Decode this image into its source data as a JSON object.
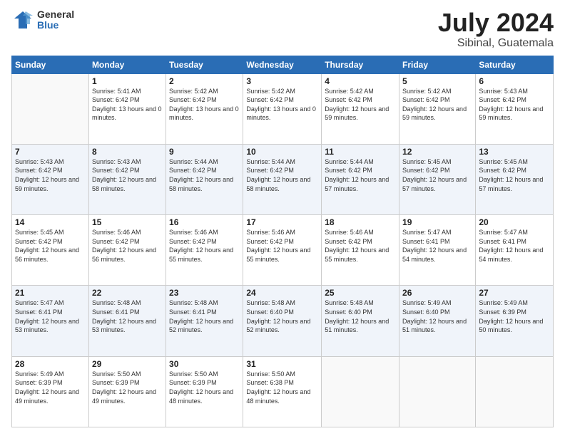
{
  "logo": {
    "general": "General",
    "blue": "Blue"
  },
  "title": {
    "month_year": "July 2024",
    "location": "Sibinal, Guatemala"
  },
  "days_of_week": [
    "Sunday",
    "Monday",
    "Tuesday",
    "Wednesday",
    "Thursday",
    "Friday",
    "Saturday"
  ],
  "weeks": [
    [
      {
        "num": "",
        "sunrise": "",
        "sunset": "",
        "daylight": ""
      },
      {
        "num": "1",
        "sunrise": "Sunrise: 5:41 AM",
        "sunset": "Sunset: 6:42 PM",
        "daylight": "Daylight: 13 hours and 0 minutes."
      },
      {
        "num": "2",
        "sunrise": "Sunrise: 5:42 AM",
        "sunset": "Sunset: 6:42 PM",
        "daylight": "Daylight: 13 hours and 0 minutes."
      },
      {
        "num": "3",
        "sunrise": "Sunrise: 5:42 AM",
        "sunset": "Sunset: 6:42 PM",
        "daylight": "Daylight: 13 hours and 0 minutes."
      },
      {
        "num": "4",
        "sunrise": "Sunrise: 5:42 AM",
        "sunset": "Sunset: 6:42 PM",
        "daylight": "Daylight: 12 hours and 59 minutes."
      },
      {
        "num": "5",
        "sunrise": "Sunrise: 5:42 AM",
        "sunset": "Sunset: 6:42 PM",
        "daylight": "Daylight: 12 hours and 59 minutes."
      },
      {
        "num": "6",
        "sunrise": "Sunrise: 5:43 AM",
        "sunset": "Sunset: 6:42 PM",
        "daylight": "Daylight: 12 hours and 59 minutes."
      }
    ],
    [
      {
        "num": "7",
        "sunrise": "Sunrise: 5:43 AM",
        "sunset": "Sunset: 6:42 PM",
        "daylight": "Daylight: 12 hours and 59 minutes."
      },
      {
        "num": "8",
        "sunrise": "Sunrise: 5:43 AM",
        "sunset": "Sunset: 6:42 PM",
        "daylight": "Daylight: 12 hours and 58 minutes."
      },
      {
        "num": "9",
        "sunrise": "Sunrise: 5:44 AM",
        "sunset": "Sunset: 6:42 PM",
        "daylight": "Daylight: 12 hours and 58 minutes."
      },
      {
        "num": "10",
        "sunrise": "Sunrise: 5:44 AM",
        "sunset": "Sunset: 6:42 PM",
        "daylight": "Daylight: 12 hours and 58 minutes."
      },
      {
        "num": "11",
        "sunrise": "Sunrise: 5:44 AM",
        "sunset": "Sunset: 6:42 PM",
        "daylight": "Daylight: 12 hours and 57 minutes."
      },
      {
        "num": "12",
        "sunrise": "Sunrise: 5:45 AM",
        "sunset": "Sunset: 6:42 PM",
        "daylight": "Daylight: 12 hours and 57 minutes."
      },
      {
        "num": "13",
        "sunrise": "Sunrise: 5:45 AM",
        "sunset": "Sunset: 6:42 PM",
        "daylight": "Daylight: 12 hours and 57 minutes."
      }
    ],
    [
      {
        "num": "14",
        "sunrise": "Sunrise: 5:45 AM",
        "sunset": "Sunset: 6:42 PM",
        "daylight": "Daylight: 12 hours and 56 minutes."
      },
      {
        "num": "15",
        "sunrise": "Sunrise: 5:46 AM",
        "sunset": "Sunset: 6:42 PM",
        "daylight": "Daylight: 12 hours and 56 minutes."
      },
      {
        "num": "16",
        "sunrise": "Sunrise: 5:46 AM",
        "sunset": "Sunset: 6:42 PM",
        "daylight": "Daylight: 12 hours and 55 minutes."
      },
      {
        "num": "17",
        "sunrise": "Sunrise: 5:46 AM",
        "sunset": "Sunset: 6:42 PM",
        "daylight": "Daylight: 12 hours and 55 minutes."
      },
      {
        "num": "18",
        "sunrise": "Sunrise: 5:46 AM",
        "sunset": "Sunset: 6:42 PM",
        "daylight": "Daylight: 12 hours and 55 minutes."
      },
      {
        "num": "19",
        "sunrise": "Sunrise: 5:47 AM",
        "sunset": "Sunset: 6:41 PM",
        "daylight": "Daylight: 12 hours and 54 minutes."
      },
      {
        "num": "20",
        "sunrise": "Sunrise: 5:47 AM",
        "sunset": "Sunset: 6:41 PM",
        "daylight": "Daylight: 12 hours and 54 minutes."
      }
    ],
    [
      {
        "num": "21",
        "sunrise": "Sunrise: 5:47 AM",
        "sunset": "Sunset: 6:41 PM",
        "daylight": "Daylight: 12 hours and 53 minutes."
      },
      {
        "num": "22",
        "sunrise": "Sunrise: 5:48 AM",
        "sunset": "Sunset: 6:41 PM",
        "daylight": "Daylight: 12 hours and 53 minutes."
      },
      {
        "num": "23",
        "sunrise": "Sunrise: 5:48 AM",
        "sunset": "Sunset: 6:41 PM",
        "daylight": "Daylight: 12 hours and 52 minutes."
      },
      {
        "num": "24",
        "sunrise": "Sunrise: 5:48 AM",
        "sunset": "Sunset: 6:40 PM",
        "daylight": "Daylight: 12 hours and 52 minutes."
      },
      {
        "num": "25",
        "sunrise": "Sunrise: 5:48 AM",
        "sunset": "Sunset: 6:40 PM",
        "daylight": "Daylight: 12 hours and 51 minutes."
      },
      {
        "num": "26",
        "sunrise": "Sunrise: 5:49 AM",
        "sunset": "Sunset: 6:40 PM",
        "daylight": "Daylight: 12 hours and 51 minutes."
      },
      {
        "num": "27",
        "sunrise": "Sunrise: 5:49 AM",
        "sunset": "Sunset: 6:39 PM",
        "daylight": "Daylight: 12 hours and 50 minutes."
      }
    ],
    [
      {
        "num": "28",
        "sunrise": "Sunrise: 5:49 AM",
        "sunset": "Sunset: 6:39 PM",
        "daylight": "Daylight: 12 hours and 49 minutes."
      },
      {
        "num": "29",
        "sunrise": "Sunrise: 5:50 AM",
        "sunset": "Sunset: 6:39 PM",
        "daylight": "Daylight: 12 hours and 49 minutes."
      },
      {
        "num": "30",
        "sunrise": "Sunrise: 5:50 AM",
        "sunset": "Sunset: 6:39 PM",
        "daylight": "Daylight: 12 hours and 48 minutes."
      },
      {
        "num": "31",
        "sunrise": "Sunrise: 5:50 AM",
        "sunset": "Sunset: 6:38 PM",
        "daylight": "Daylight: 12 hours and 48 minutes."
      },
      {
        "num": "",
        "sunrise": "",
        "sunset": "",
        "daylight": ""
      },
      {
        "num": "",
        "sunrise": "",
        "sunset": "",
        "daylight": ""
      },
      {
        "num": "",
        "sunrise": "",
        "sunset": "",
        "daylight": ""
      }
    ]
  ]
}
